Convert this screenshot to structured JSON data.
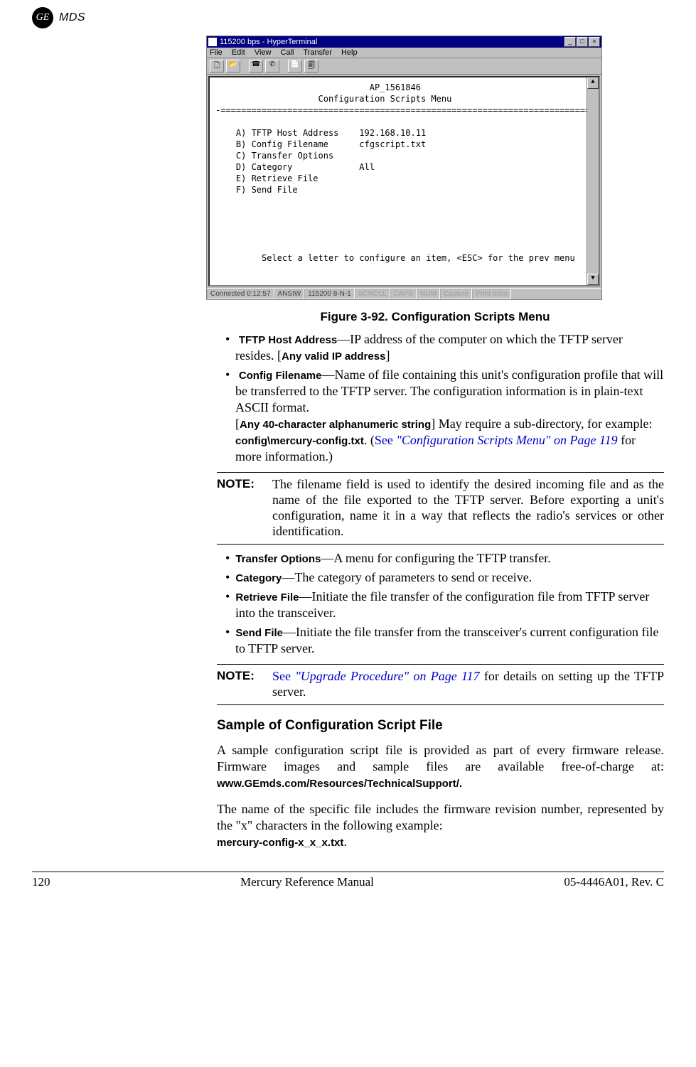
{
  "header": {
    "logo_text": "GE",
    "brand": "MDS"
  },
  "terminal": {
    "title": "115200 bps - HyperTerminal",
    "menus": [
      "File",
      "Edit",
      "View",
      "Call",
      "Transfer",
      "Help"
    ],
    "body_lines": [
      "                              AP_1561846",
      "                    Configuration Scripts Menu",
      "-==========================================================================-",
      "",
      "    A) TFTP Host Address    192.168.10.11",
      "    B) Config Filename      cfgscript.txt",
      "    C) Transfer Options",
      "    D) Category             All",
      "    E) Retrieve File",
      "    F) Send File",
      "",
      "",
      "",
      "",
      "",
      "         Select a letter to configure an item, <ESC> for the prev menu     _"
    ],
    "status": [
      "Connected 0:12:57",
      "ANSIW",
      "115200 8-N-1",
      "SCROLL",
      "CAPS",
      "NUM",
      "Capture",
      "Print echo"
    ]
  },
  "figure_caption": "Figure 3-92. Configuration Scripts Menu",
  "bullets_a": [
    {
      "term": "TFTP Host Address",
      "desc_plain_1": "—IP address of the computer on which the TFTP server resides. [",
      "bracket": "Any valid IP address",
      "desc_plain_2": "]"
    },
    {
      "term": "Config Filename",
      "desc_line1": "—Name of file containing this unit's configura­tion profile that will be transferred to the TFTP server. The con­figuration information is in plain-text ASCII format.",
      "bracket2": "Any 40-character alphanumeric string",
      "desc_line2a": " May require a sub-direc­tory, for example: ",
      "code": "config\\mercury-config.txt",
      "desc_line2b": ". (",
      "see": "See ",
      "link_ital": "\"Configuration Scripts Menu\" on Page 119",
      "desc_line2c": " for more information.)"
    }
  ],
  "note1": {
    "label": "NOTE:",
    "body": "The filename field is used to identify the desired incoming file and as the name of the file exported to the TFTP server. Before exporting a unit's configuration, name it in a way that reflects the radio's services or other identification."
  },
  "bullets_b": [
    {
      "term": "Transfer Options",
      "desc": "—A menu for configuring the TFTP transfer."
    },
    {
      "term": "Category",
      "desc": "—The category of parameters to send or receive."
    },
    {
      "term": "Retrieve File",
      "desc": "—Initiate the file transfer of the configuration file from TFTP server into the transceiver."
    },
    {
      "term": "Send File",
      "desc": "—Initiate the file transfer from the transceiver's current configuration file to TFTP server."
    }
  ],
  "note2": {
    "label": "NOTE:",
    "see": "See ",
    "link_ital": "\"Upgrade Procedure\" on Page 117",
    "rest": " for details on setting up the TFTP server."
  },
  "subhead": "Sample of Configuration Script File",
  "para1_a": "A sample configuration script file is provided as part of every firmware release. Firmware images and sample files are available free-of-charge at: ",
  "para1_link": "www.GEmds.com/Resources/TechnicalSupport/.",
  "para2_a": "The name of the specific file includes the firmware revision number, represented by the \"x\" characters in the following example: ",
  "para2_code": "mercury-config-x_x_x.txt",
  "para2_b": ".",
  "footer": {
    "page": "120",
    "center": "Mercury Reference Manual",
    "right": "05-4446A01, Rev. C"
  }
}
